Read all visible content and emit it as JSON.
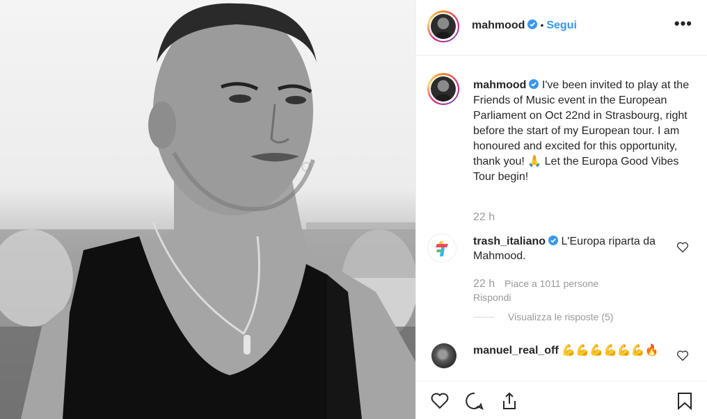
{
  "post": {
    "author": "mahmood",
    "follow_label": "Segui",
    "separator": "•",
    "more_label": "•••"
  },
  "caption": {
    "username": "mahmood",
    "text": "I've been invited to play at the Friends of Music event in the European Parliament on Oct 22nd in Strasbourg, right before the start of my European tour. I am honoured and excited for this opportunity, thank you!",
    "text_tail": "Let the Europa Good Vibes Tour begin!",
    "emoji": "🙏",
    "time": "22 h"
  },
  "comments": [
    {
      "username": "trash_italiano",
      "text": "L'Europa riparta da Mahmood.",
      "time": "22 h",
      "likes": "Piace a 1011 persone",
      "reply": "Rispondi",
      "view_replies": "Visualizza le risposte (5)"
    },
    {
      "username": "manuel_real_off",
      "text": "💪💪💪💪💪💪🔥"
    }
  ],
  "icons": {
    "like": "heart-icon",
    "comment": "comment-icon",
    "share": "share-icon",
    "save": "bookmark-icon",
    "verified": "verified-badge-icon",
    "more": "more-options-icon"
  },
  "colors": {
    "accent": "#3897f0",
    "text": "#262626",
    "muted": "#999999",
    "border": "#efefef"
  }
}
